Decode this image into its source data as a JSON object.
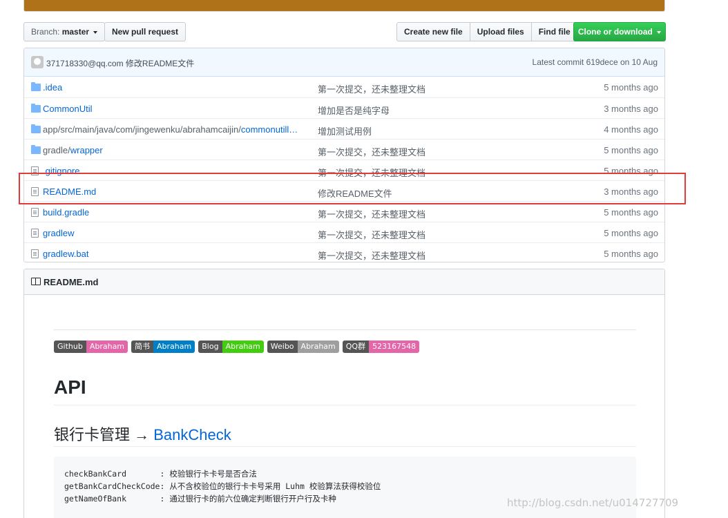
{
  "toolbar": {
    "branch_prefix": "Branch:",
    "branch_name": "master",
    "new_pull_request": "New pull request",
    "create_new_file": "Create new file",
    "upload_files": "Upload files",
    "find_file": "Find file",
    "clone_or_download": "Clone or download"
  },
  "commit": {
    "author_message": "371718330@qq.com 修改README文件",
    "latest": "Latest commit 619dece on 10 Aug"
  },
  "files": [
    {
      "type": "dir",
      "name": ".idea",
      "name_dir": "",
      "message": "第一次提交，还未整理文档",
      "age": "5 months ago"
    },
    {
      "type": "dir",
      "name": "CommonUtil",
      "name_dir": "",
      "message": "增加是否是纯字母",
      "age": "3 months ago"
    },
    {
      "type": "dir",
      "name": "commonutill…",
      "name_dir": "app/src/main/java/com/jingewenku/abrahamcaijin/",
      "message": "增加测试用例",
      "age": "4 months ago"
    },
    {
      "type": "dir",
      "name": "wrapper",
      "name_dir": "gradle/",
      "message": "第一次提交，还未整理文档",
      "age": "5 months ago"
    },
    {
      "type": "file",
      "name": ".gitignore",
      "name_dir": "",
      "message": "第一次提交，还未整理文档",
      "age": "5 months ago"
    },
    {
      "type": "file",
      "name": "README.md",
      "name_dir": "",
      "message": "修改README文件",
      "age": "3 months ago"
    },
    {
      "type": "file",
      "name": "build.gradle",
      "name_dir": "",
      "message": "第一次提交，还未整理文档",
      "age": "5 months ago"
    },
    {
      "type": "file",
      "name": "gradlew",
      "name_dir": "",
      "message": "第一次提交，还未整理文档",
      "age": "5 months ago"
    },
    {
      "type": "file",
      "name": "gradlew.bat",
      "name_dir": "",
      "message": "第一次提交，还未整理文档",
      "age": "5 months ago"
    }
  ],
  "readme": {
    "title": "README.md",
    "badges": [
      {
        "left": "Github",
        "right": "Abraham",
        "color": "#e466a8"
      },
      {
        "left": "简书",
        "right": "Abraham",
        "color": "#007ec6"
      },
      {
        "left": "Blog",
        "right": "Abraham",
        "color": "#4c1"
      },
      {
        "left": "Weibo",
        "right": "Abraham",
        "color": "#9f9f9f"
      },
      {
        "left": "QQ群",
        "right": "523167548",
        "color": "#e466a8"
      }
    ],
    "h1": "API",
    "h3_prefix": "银行卡管理 → ",
    "h3_link": "BankCheck",
    "code_lines": [
      "checkBankCard       : 校验银行卡卡号是否合法",
      "getBankCardCheckCode: 从不含校验位的银行卡卡号采用 Luhm 校验算法获得校验位",
      "getNameOfBank       : 通过银行卡的前六位确定判断银行开户行及卡种"
    ]
  },
  "watermark": "http://blog.csdn.net/u014727709",
  "colors": {
    "link": "#0366d6",
    "green_button": "#28a745",
    "highlight_box": "#e03a3a",
    "top_bar": "#b07219"
  }
}
